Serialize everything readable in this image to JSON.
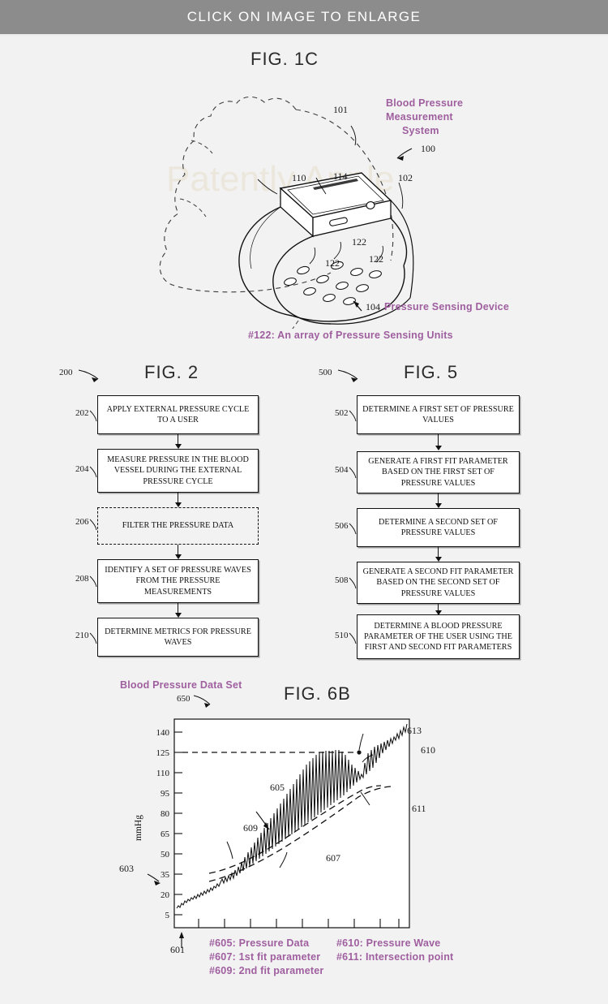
{
  "banner": {
    "label": "CLICK ON IMAGE TO ENLARGE"
  },
  "watermark": {
    "text": "Patently Apple"
  },
  "fig1c": {
    "title": "FIG. 1C",
    "callouts": {
      "system_title_line1": "Blood Pressure",
      "system_title_line2": "Measurement",
      "system_title_line3": "System",
      "system_number": "100",
      "arm": "101",
      "band_right": "102",
      "device_body": "110",
      "display": "114",
      "sensor_device_num": "104",
      "sensor_device_label": "Pressure Sensing Device",
      "unit_a": "122",
      "unit_b": "122",
      "unit_c": "122",
      "array_note": "#122: An array of Pressure Sensing Units"
    }
  },
  "fig2": {
    "title": "FIG. 2",
    "flow_number": "200",
    "steps": [
      {
        "num": "202",
        "text": "APPLY EXTERNAL PRESSURE CYCLE TO A USER",
        "dashed": false
      },
      {
        "num": "204",
        "text": "MEASURE PRESSURE IN THE BLOOD VESSEL DURING THE EXTERNAL PRESSURE CYCLE",
        "dashed": false
      },
      {
        "num": "206",
        "text": "FILTER THE PRESSURE DATA",
        "dashed": true
      },
      {
        "num": "208",
        "text": "IDENTIFY A SET OF PRESSURE WAVES FROM THE PRESSURE MEASUREMENTS",
        "dashed": false
      },
      {
        "num": "210",
        "text": "DETERMINE METRICS FOR PRESSURE WAVES",
        "dashed": false
      }
    ]
  },
  "fig5": {
    "title": "FIG. 5",
    "flow_number": "500",
    "steps": [
      {
        "num": "502",
        "text": "DETERMINE A FIRST SET OF PRESSURE VALUES",
        "dashed": false
      },
      {
        "num": "504",
        "text": "GENERATE A FIRST FIT PARAMETER BASED ON THE FIRST SET OF PRESSURE VALUES",
        "dashed": false
      },
      {
        "num": "506",
        "text": "DETERMINE A SECOND SET OF PRESSURE VALUES",
        "dashed": false
      },
      {
        "num": "508",
        "text": "GENERATE A SECOND FIT PARAMETER BASED ON THE SECOND SET OF PRESSURE VALUES",
        "dashed": false
      },
      {
        "num": "510",
        "text": "DETERMINE A BLOOD PRESSURE PARAMETER OF THE USER USING THE FIRST AND SECOND FIT PARAMETERS",
        "dashed": false
      }
    ]
  },
  "fig6b": {
    "title": "FIG. 6B",
    "dataset_label": "Blood Pressure Data Set",
    "dataset_number": "650",
    "y_axis_ref": "603",
    "x_axis_ref": "601",
    "inline_refs": {
      "pressure_data": "605",
      "first_fit": "607",
      "second_fit": "609",
      "pressure_wave": "610",
      "intersection": "611",
      "threshold_point": "613"
    },
    "legend": [
      "#605: Pressure Data",
      "#607: 1st fit parameter",
      "#609: 2nd fit parameter",
      "#610: Pressure Wave",
      "#611: Intersection point"
    ]
  },
  "chart_data": {
    "type": "line",
    "title": "FIG. 6B",
    "subtitle": "Blood Pressure Data Set",
    "xlabel": "",
    "ylabel": "mmHg",
    "ylim": [
      0,
      148
    ],
    "yticks": [
      5,
      20,
      35,
      50,
      65,
      80,
      95,
      110,
      125,
      140
    ],
    "ytick_labels": [
      "5",
      "20",
      "35",
      "50",
      "65",
      "80",
      "95",
      "110",
      "125",
      "140"
    ],
    "xlim": [
      0,
      100
    ],
    "xticks": [
      5,
      15,
      25,
      35,
      45,
      55,
      65,
      75,
      85,
      95
    ],
    "xtick_labels": [
      "",
      "",
      "",
      "",
      "",
      "",
      "",
      "",
      "",
      ""
    ],
    "grid": false,
    "legend_position": "below-axes",
    "annotations": [
      {
        "label": "605",
        "meaning": "Pressure Data",
        "x": 38,
        "y": 95
      },
      {
        "label": "607",
        "meaning": "1st fit parameter",
        "x": 62,
        "y": 47
      },
      {
        "label": "609",
        "meaning": "2nd fit parameter",
        "x": 26,
        "y": 64
      },
      {
        "label": "610",
        "meaning": "Pressure Wave",
        "x": 90,
        "y": 123
      },
      {
        "label": "611",
        "meaning": "Intersection point",
        "x": 84,
        "y": 80
      },
      {
        "label": "613",
        "meaning": "125 mmHg threshold crossing",
        "x": 80,
        "y": 133
      },
      {
        "label": "601",
        "meaning": "x-axis (time)",
        "x": 2,
        "y": 0
      },
      {
        "label": "603",
        "meaning": "y-axis (mmHg)",
        "x": 0,
        "y": 35
      },
      {
        "label": "650",
        "meaning": "Blood Pressure Data Set",
        "x": 12,
        "y": 146
      }
    ],
    "reference_lines": [
      {
        "name": "threshold",
        "axis": "y",
        "value": 125,
        "style": "dashed"
      }
    ],
    "series": [
      {
        "name": "605 Pressure Data",
        "style": "solid",
        "description": "Oscillometric pressure signal: slowly rising baseline with superimposed pulsatile pressure waves of increasing amplitude",
        "x": [
          0,
          2,
          4,
          6,
          8,
          10,
          12,
          14,
          16,
          18,
          20,
          22,
          24,
          26,
          28,
          30,
          32,
          34,
          36,
          38,
          40,
          42,
          44,
          46,
          48,
          50,
          52,
          54,
          56,
          58,
          60,
          62,
          64,
          66,
          68,
          70,
          72,
          74,
          76,
          78,
          80,
          82,
          84,
          86,
          88,
          90,
          92,
          94,
          96,
          98,
          100
        ],
        "y": [
          15,
          17,
          18,
          20,
          21,
          22,
          24,
          25,
          27,
          28,
          30,
          32,
          34,
          35,
          37,
          39,
          41,
          43,
          45,
          47,
          49,
          51,
          53,
          56,
          58,
          60,
          62,
          65,
          67,
          69,
          71,
          74,
          76,
          78,
          80,
          82,
          85,
          87,
          89,
          92,
          94,
          97,
          100,
          103,
          107,
          110,
          114,
          118,
          123,
          128,
          135
        ],
        "peaks_y": [
          null,
          null,
          null,
          null,
          null,
          null,
          null,
          null,
          null,
          null,
          40,
          44,
          48,
          52,
          57,
          61,
          66,
          70,
          75,
          79,
          84,
          88,
          93,
          97,
          102,
          106,
          110,
          113,
          116,
          118,
          120,
          122,
          123,
          124,
          125,
          126,
          127,
          129,
          131,
          133,
          135,
          137,
          138,
          139,
          140,
          141,
          141,
          142,
          142,
          143,
          143
        ]
      },
      {
        "name": "607 1st fit parameter",
        "style": "dashed",
        "description": "Lower envelope fit through the pressure wave troughs",
        "x": [
          14,
          20,
          30,
          40,
          50,
          60,
          70,
          80,
          88
        ],
        "y": [
          33,
          36,
          42,
          50,
          58,
          67,
          76,
          86,
          94
        ]
      },
      {
        "name": "609 2nd fit parameter",
        "style": "dashed",
        "description": "Upper envelope fit through the pressure wave crests",
        "x": [
          14,
          20,
          30,
          40,
          50,
          60,
          70,
          78,
          85,
          92
        ],
        "y": [
          38,
          40,
          47,
          55,
          64,
          74,
          83,
          89,
          92,
          93
        ]
      },
      {
        "name": "610 Pressure Wave",
        "style": "solid",
        "description": "Individual pulsatile pressure wave feature marked near 125 mmHg"
      }
    ]
  }
}
